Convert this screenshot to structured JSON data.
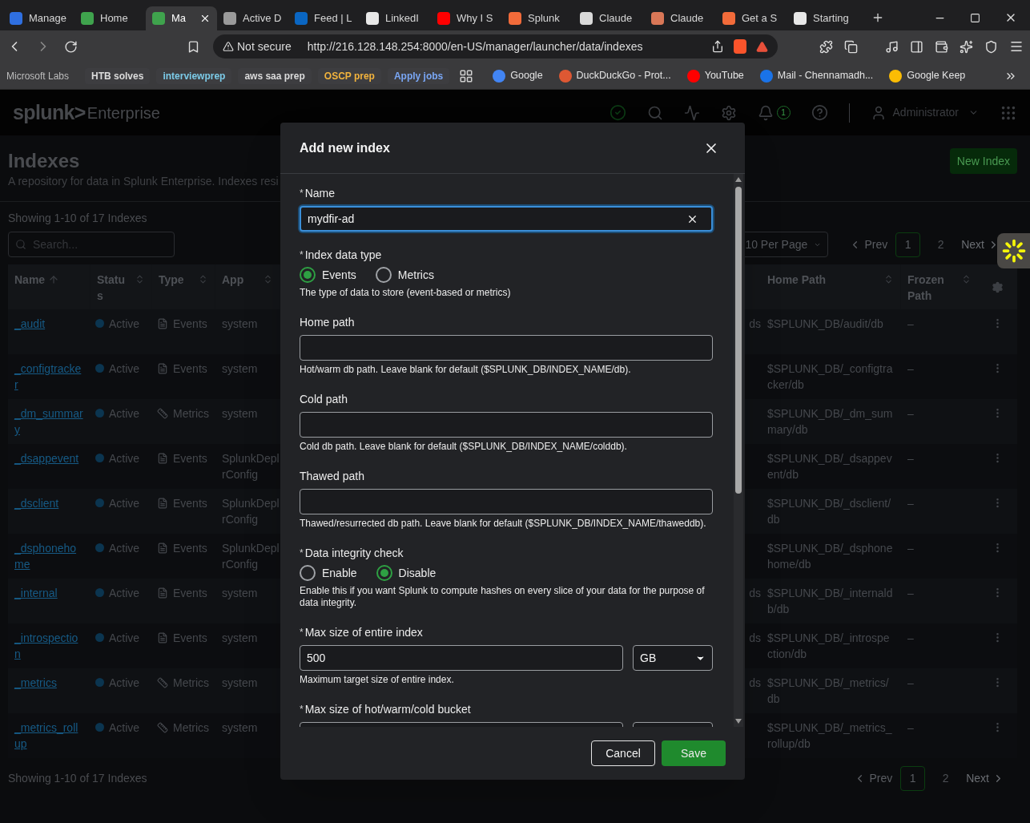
{
  "browser": {
    "tabs": [
      {
        "title": "Manage",
        "selected": false,
        "color": "#2f6fe0"
      },
      {
        "title": "Home",
        "selected": false,
        "color": "#3fa34d"
      },
      {
        "title": "Ma",
        "selected": true,
        "color": "#3fa34d"
      },
      {
        "title": "Active D",
        "selected": false,
        "color": "#9a9a9a"
      },
      {
        "title": "Feed | L",
        "selected": false,
        "color": "#0a66c2"
      },
      {
        "title": "LinkedI",
        "selected": false,
        "color": "#e8e8e8"
      },
      {
        "title": "Why I S",
        "selected": false,
        "color": "#ff0000"
      },
      {
        "title": "Splunk",
        "selected": false,
        "color": "#f26b3a"
      },
      {
        "title": "Claude",
        "selected": false,
        "color": "#d9d9d9"
      },
      {
        "title": "Claude",
        "selected": false,
        "color": "#d97757"
      },
      {
        "title": "Get a S",
        "selected": false,
        "color": "#f26b3a"
      },
      {
        "title": "Starting",
        "selected": false,
        "color": "#e8e8e8"
      }
    ],
    "address": {
      "security": "Not secure",
      "url": "http://216.128.148.254:8000/en-US/manager/launcher/data/indexes"
    },
    "bookmarks": [
      {
        "label": "Microsoft Labs",
        "kind": "plain"
      },
      {
        "label": "HTB solves",
        "kind": "chip",
        "color": "#dcdcdc"
      },
      {
        "label": "interviewprep",
        "kind": "chip",
        "color": "#7ccbe8"
      },
      {
        "label": "aws saa prep",
        "kind": "chip",
        "color": "#dcdcdc"
      },
      {
        "label": "OSCP prep",
        "kind": "chip",
        "color": "#f2b33d"
      },
      {
        "label": "Apply jobs",
        "kind": "chip",
        "color": "#7aa7f5"
      },
      {
        "kind": "apps"
      },
      {
        "label": "Google",
        "kind": "site",
        "color": "#4285f4"
      },
      {
        "label": "DuckDuckGo - Prot...",
        "kind": "site",
        "color": "#de5833"
      },
      {
        "label": "YouTube",
        "kind": "site",
        "color": "#ff0000"
      },
      {
        "label": "Mail - Chennamadh...",
        "kind": "site",
        "color": "#1a73e8"
      },
      {
        "label": "Google Keep",
        "kind": "site",
        "color": "#fbbc04"
      }
    ]
  },
  "header": {
    "logo": "splunk>",
    "product": "Enterprise",
    "notifications": "1",
    "user": "Administrator"
  },
  "page": {
    "title": "Indexes",
    "description": "A repository for data in Splunk Enterprise. Indexes resi",
    "new_button": "New Index",
    "count_top": "Showing 1-10 of 17 Indexes",
    "search": {
      "placeholder": "Search..."
    },
    "per_page": "10 Per Page",
    "pagination_top": {
      "prev": "Prev",
      "pages": [
        {
          "label": "1",
          "selected": true
        },
        {
          "label": "2",
          "selected": false
        }
      ],
      "next": "Next"
    },
    "count_bottom": "Showing 1-10 of 17 Indexes",
    "pagination_bottom": {
      "prev": "Prev",
      "pages": [
        {
          "label": "1",
          "selected": true
        },
        {
          "label": "2",
          "selected": false
        }
      ],
      "next": "Next"
    }
  },
  "table": {
    "columns": [
      {
        "label": "Name",
        "sorted": true
      },
      {
        "label": "Status",
        "sorted": false
      },
      {
        "label": "Type",
        "sorted": false
      },
      {
        "label": "App",
        "sorted": false
      },
      {
        "label": "Home Path",
        "sorted": false
      },
      {
        "label": "Frozen Path",
        "sorted": false
      }
    ],
    "rows": [
      {
        "name": "_audit",
        "status": "Active",
        "type": "Events",
        "kind": "events",
        "app": "system",
        "column_5": "ds",
        "home": "$SPLUNK_DB/audit/db",
        "frozen": "–"
      },
      {
        "name": "_configtracker",
        "status": "Active",
        "type": "Events",
        "kind": "events",
        "app": "system",
        "home": "$SPLUNK_DB/_configtracker/db",
        "frozen": "–"
      },
      {
        "name": "_dm_summary",
        "status": "Active",
        "type": "Metrics",
        "kind": "metrics",
        "app": "system",
        "home": "$SPLUNK_DB/_dm_summary/db",
        "frozen": "–"
      },
      {
        "name": "_dsappevent",
        "status": "Active",
        "type": "Events",
        "kind": "events",
        "app": "SplunkDepl rConfig",
        "home": "$SPLUNK_DB/_dsappevent/db",
        "frozen": "–"
      },
      {
        "name": "_dsclient",
        "status": "Active",
        "type": "Events",
        "kind": "events",
        "app": "SplunkDepl rConfig",
        "home": "$SPLUNK_DB/_dsclient/db",
        "frozen": "–"
      },
      {
        "name": "_dsphonehome",
        "status": "Active",
        "type": "Events",
        "kind": "events",
        "app": "SplunkDepl rConfig",
        "home": "$SPLUNK_DB/_dsphonehome/db",
        "frozen": "–"
      },
      {
        "name": "_internal",
        "status": "Active",
        "type": "Events",
        "kind": "events",
        "app": "system",
        "column_5": "ds",
        "home": "$SPLUNK_DB/_internaldb/db",
        "frozen": "–"
      },
      {
        "name": "_introspection",
        "status": "Active",
        "type": "Events",
        "kind": "events",
        "app": "system",
        "column_5": "ds",
        "home": "$SPLUNK_DB/_introspection/db",
        "frozen": "–"
      },
      {
        "name": "_metrics",
        "status": "Active",
        "type": "Metrics",
        "kind": "metrics",
        "app": "system",
        "column_5": "ds",
        "home": "$SPLUNK_DB/_metrics/db",
        "frozen": "–"
      },
      {
        "name": "_metrics_rollup",
        "status": "Active",
        "type": "Metrics",
        "kind": "metrics",
        "app": "system",
        "home": "$SPLUNK_DB/_metrics_rollup/db",
        "frozen": "–"
      }
    ]
  },
  "dialog": {
    "title": "Add new index",
    "fields": [
      {
        "kind": "text",
        "required_mark": "*",
        "label": "Name",
        "value": "mydfir-ad",
        "focused": true,
        "clearable": true
      },
      {
        "kind": "radio",
        "required_mark": "*",
        "label": "Index data type",
        "options": [
          {
            "label": "Events",
            "selected": true
          },
          {
            "label": "Metrics",
            "selected": false
          }
        ],
        "help": "The type of data to store (event-based or metrics)"
      },
      {
        "kind": "text",
        "label": "Home path",
        "focused": false,
        "help": "Hot/warm db path. Leave blank for default ($SPLUNK_DB/INDEX_NAME/db)."
      },
      {
        "kind": "text",
        "label": "Cold path",
        "focused": false,
        "help": "Cold db path. Leave blank for default ($SPLUNK_DB/INDEX_NAME/colddb)."
      },
      {
        "kind": "text",
        "label": "Thawed path",
        "focused": false,
        "help": "Thawed/resurrected db path. Leave blank for default ($SPLUNK_DB/INDEX_NAME/thaweddb)."
      },
      {
        "kind": "radio",
        "required_mark": "*",
        "label": "Data integrity check",
        "options": [
          {
            "label": "Enable",
            "selected": false
          },
          {
            "label": "Disable",
            "selected": true
          }
        ],
        "help": "Enable this if you want Splunk to compute hashes on every slice of your data for the purpose of data integrity."
      },
      {
        "kind": "size",
        "required_mark": "*",
        "label": "Max size of entire index",
        "value": "500",
        "unit": "GB",
        "help": "Maximum target size of entire index."
      },
      {
        "kind": "size",
        "required_mark": "*",
        "label": "Max size of hot/warm/cold bucket"
      }
    ],
    "buttons": [
      {
        "label": "Cancel",
        "kind": "secondary"
      },
      {
        "label": "Save",
        "kind": "primary"
      }
    ]
  }
}
